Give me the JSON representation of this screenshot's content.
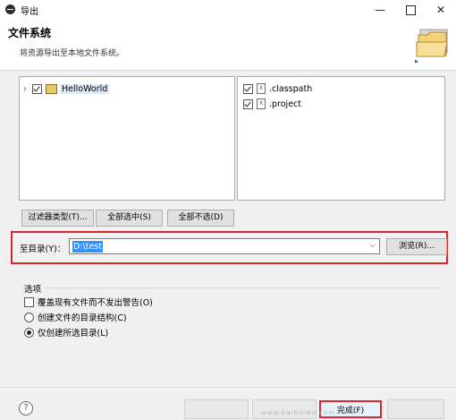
{
  "window": {
    "title": "导出"
  },
  "header": {
    "title": "文件系统",
    "description": "将资源导出至本地文件系统。"
  },
  "tree": {
    "projects": [
      {
        "label": "HelloWorld",
        "checked": true
      }
    ]
  },
  "files": [
    {
      "label": ".classpath",
      "checked": true
    },
    {
      "label": ".project",
      "checked": true
    }
  ],
  "selection_buttons": {
    "filter": "过滤器类型(T)...",
    "select_all": "全部选中(S)",
    "deselect_all": "全部不选(D)"
  },
  "destination": {
    "label": "至目录(Y)：",
    "value": "D:\\test",
    "browse": "浏览(R)..."
  },
  "options": {
    "title": "选项",
    "overwrite": "覆盖现有文件而不发出警告(O)",
    "create_structure": "创建文件的目录结构(C)",
    "create_selected_only": "仅创建所选目录(L)"
  },
  "footer": {
    "finish": "完成(F)",
    "watermark": "www.baibaiwo.com"
  },
  "colors": {
    "highlight": "#e0252a",
    "selection": "#3390ff"
  }
}
